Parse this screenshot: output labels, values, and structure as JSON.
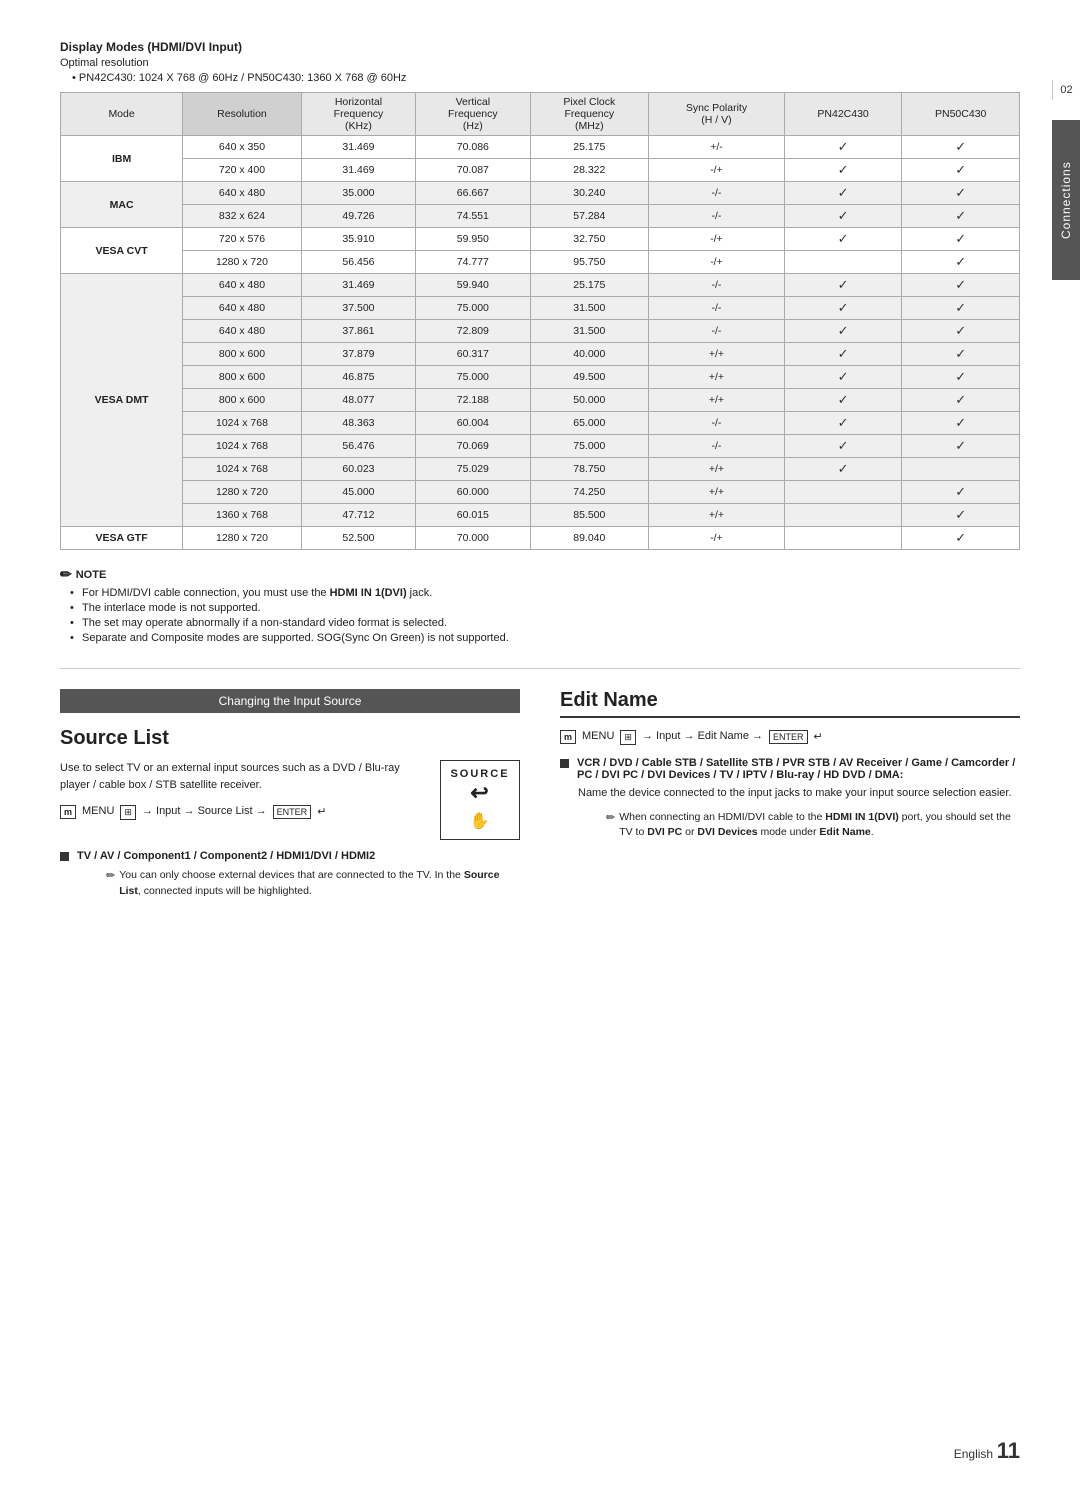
{
  "page": {
    "side_label": "Connections",
    "side_num": "02",
    "section1": {
      "title": "Display Modes (HDMI/DVI Input)",
      "optimal": "Optimal resolution",
      "bullet": "PN42C430: 1024 X 768 @ 60Hz / PN50C430: 1360 X 768 @ 60Hz"
    },
    "table": {
      "headers": [
        "Mode",
        "Resolution",
        "Horizontal\nFrequency\n(KHz)",
        "Vertical\nFrequency\n(Hz)",
        "Pixel Clock\nFrequency\n(MHz)",
        "Sync Polarity\n(H / V)",
        "PN42C430",
        "PN50C430"
      ],
      "rows": [
        {
          "mode": "IBM",
          "resolutions": [
            "640 x 350",
            "720 x 400"
          ],
          "hfreqs": [
            "31.469",
            "31.469"
          ],
          "vfreqs": [
            "70.086",
            "70.087"
          ],
          "pclocks": [
            "25.175",
            "28.322"
          ],
          "sync": [
            "+/-",
            "-/+"
          ],
          "pn42": [
            true,
            true
          ],
          "pn50": [
            true,
            true
          ],
          "highlight": false
        },
        {
          "mode": "MAC",
          "resolutions": [
            "640 x 480",
            "832 x 624"
          ],
          "hfreqs": [
            "35.000",
            "49.726"
          ],
          "vfreqs": [
            "66.667",
            "74.551"
          ],
          "pclocks": [
            "30.240",
            "57.284"
          ],
          "sync": [
            "-/-",
            "-/-"
          ],
          "pn42": [
            true,
            true
          ],
          "pn50": [
            true,
            true
          ],
          "highlight": true
        },
        {
          "mode": "VESA CVT",
          "resolutions": [
            "720 x 576",
            "1280 x 720"
          ],
          "hfreqs": [
            "35.910",
            "56.456"
          ],
          "vfreqs": [
            "59.950",
            "74.777"
          ],
          "pclocks": [
            "32.750",
            "95.750"
          ],
          "sync": [
            "-/+",
            "-/+"
          ],
          "pn42": [
            true,
            false
          ],
          "pn50": [
            true,
            true
          ],
          "highlight": false
        },
        {
          "mode": "VESA DMT",
          "resolutions": [
            "640 x 480",
            "640 x 480",
            "640 x 480",
            "800 x 600",
            "800 x 600",
            "800 x 600",
            "1024 x 768",
            "1024 x 768",
            "1024 x 768",
            "1280 x 720",
            "1360 x 768"
          ],
          "hfreqs": [
            "31.469",
            "37.500",
            "37.861",
            "37.879",
            "46.875",
            "48.077",
            "48.363",
            "56.476",
            "60.023",
            "45.000",
            "47.712"
          ],
          "vfreqs": [
            "59.940",
            "75.000",
            "72.809",
            "60.317",
            "75.000",
            "72.188",
            "60.004",
            "70.069",
            "75.029",
            "60.000",
            "60.015"
          ],
          "pclocks": [
            "25.175",
            "31.500",
            "31.500",
            "40.000",
            "49.500",
            "50.000",
            "65.000",
            "75.000",
            "78.750",
            "74.250",
            "85.500"
          ],
          "sync": [
            "-/-",
            "-/-",
            "-/-",
            "+/+",
            "+/+",
            "+/+",
            "-/-",
            "-/-",
            "+/+",
            "+/+",
            "+/+"
          ],
          "pn42": [
            true,
            true,
            true,
            true,
            true,
            true,
            true,
            true,
            true,
            false,
            false
          ],
          "pn50": [
            true,
            true,
            true,
            true,
            true,
            true,
            true,
            true,
            false,
            true,
            true
          ],
          "highlight": true
        },
        {
          "mode": "VESA GTF",
          "resolutions": [
            "1280 x 720"
          ],
          "hfreqs": [
            "52.500"
          ],
          "vfreqs": [
            "70.000"
          ],
          "pclocks": [
            "89.040"
          ],
          "sync": [
            "-/+"
          ],
          "pn42": [
            false
          ],
          "pn50": [
            true
          ],
          "highlight": false
        }
      ]
    },
    "note": {
      "title": "NOTE",
      "items": [
        "For HDMI/DVI cable connection, you must use the HDMI IN 1(DVI) jack.",
        "The interlace mode is not supported.",
        "The set may operate abnormally if a non-standard video format is selected.",
        "Separate and Composite modes are supported. SOG(Sync On Green) is not supported."
      ],
      "bold_parts": [
        "HDMI IN 1(DVI)"
      ]
    },
    "source_list": {
      "bar_label": "Changing the Input Source",
      "heading": "Source List",
      "description": "Use to select TV or an external input sources such as a DVD / Blu-ray player / cable box / STB satellite receiver.",
      "menu_text": "MENU",
      "menu_path": "→ Input → Source List →",
      "enter_text": "ENTER",
      "source_label": "SOURCE",
      "bullet1_label": "TV / AV / Component1 / Component2 / HDMI1/DVI / HDMI2",
      "bullet1_sub": "You can only choose external devices that are connected to the TV. In the Source List, connected inputs will be highlighted."
    },
    "edit_name": {
      "heading": "Edit Name",
      "menu_text": "MENU",
      "menu_path": "→ Input → Edit Name →",
      "enter_text": "ENTER",
      "bullet1_label": "VCR / DVD / Cable STB / Satellite STB / PVR STB / AV Receiver / Game / Camcorder / PC / DVI PC / DVI Devices / TV / IPTV / Blu-ray / HD DVD / DMA:",
      "bullet1_body": "Name the device connected to the input jacks to make your input source selection easier.",
      "sub_note": "When connecting an HDMI/DVI cable to the HDMI IN 1(DVI) port, you should set the TV to DVI PC or DVI Devices mode under Edit Name."
    },
    "footer": {
      "lang": "English",
      "page": "11"
    }
  }
}
